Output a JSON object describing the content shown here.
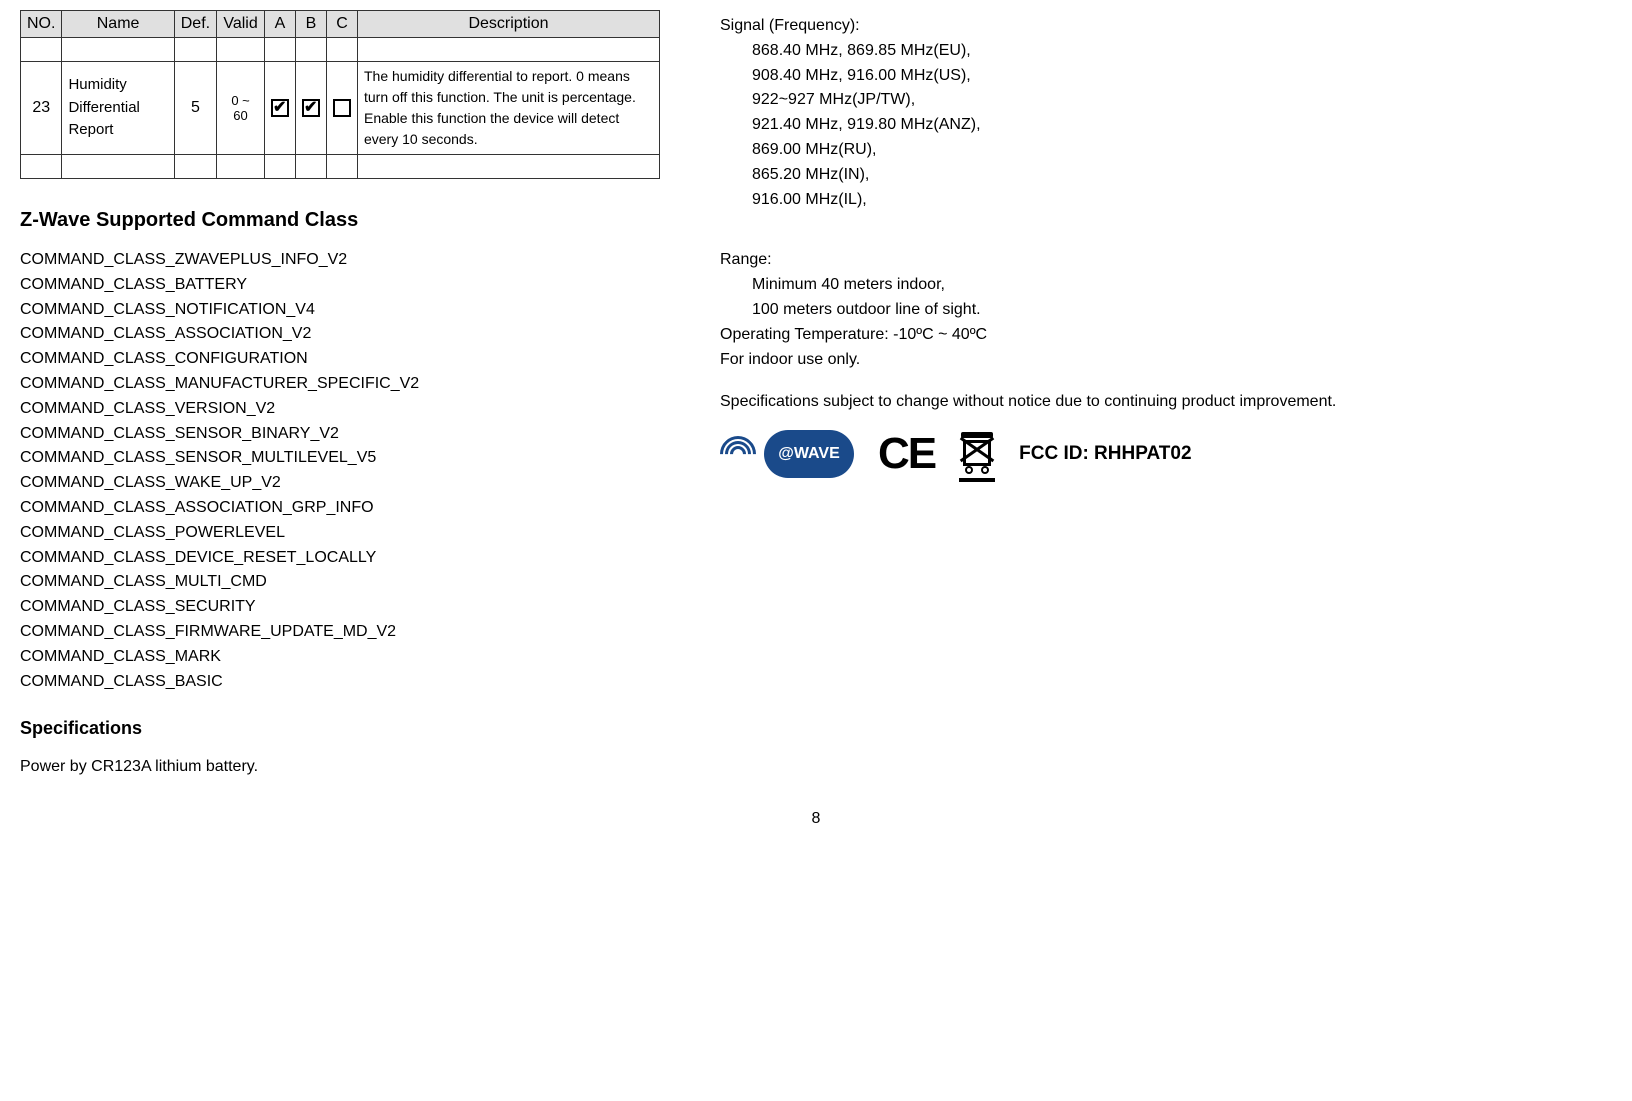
{
  "table": {
    "headers": {
      "no": "NO.",
      "name": "Name",
      "def": "Def.",
      "valid": "Valid",
      "a": "A",
      "b": "B",
      "c": "C",
      "description": "Description"
    },
    "row": {
      "no": "23",
      "name": "Humidity Differential Report",
      "def": "5",
      "valid": "0 ~ 60",
      "a_checked": true,
      "b_checked": true,
      "c_checked": false,
      "description": "The humidity differential to report. 0 means turn off this function. The unit is percentage. Enable this function the device will detect every 10 seconds."
    }
  },
  "zwave_heading": "Z-Wave Supported Command Class",
  "command_classes": [
    "COMMAND_CLASS_ZWAVEPLUS_INFO_V2",
    "COMMAND_CLASS_BATTERY",
    "COMMAND_CLASS_NOTIFICATION_V4",
    "COMMAND_CLASS_ASSOCIATION_V2",
    "COMMAND_CLASS_CONFIGURATION",
    "COMMAND_CLASS_MANUFACTURER_SPECIFIC_V2",
    "COMMAND_CLASS_VERSION_V2",
    "COMMAND_CLASS_SENSOR_BINARY_V2",
    "COMMAND_CLASS_SENSOR_MULTILEVEL_V5",
    "COMMAND_CLASS_WAKE_UP_V2",
    "COMMAND_CLASS_ASSOCIATION_GRP_INFO",
    "COMMAND_CLASS_POWERLEVEL",
    "COMMAND_CLASS_DEVICE_RESET_LOCALLY",
    "COMMAND_CLASS_MULTI_CMD",
    "COMMAND_CLASS_SECURITY",
    "COMMAND_CLASS_FIRMWARE_UPDATE_MD_V2",
    "COMMAND_CLASS_MARK",
    "COMMAND_CLASS_BASIC"
  ],
  "specifications": {
    "heading": "Specifications",
    "power": "Power by CR123A lithium battery.",
    "signal_label": "Signal (Frequency):",
    "signal_lines": [
      "868.40 MHz, 869.85 MHz(EU),",
      "908.40 MHz, 916.00 MHz(US),",
      "922~927 MHz(JP/TW),",
      "921.40 MHz, 919.80 MHz(ANZ),",
      "869.00 MHz(RU),",
      "865.20 MHz(IN),",
      "916.00 MHz(IL),"
    ],
    "range_label": "Range:",
    "range_lines": [
      "Minimum 40 meters indoor,",
      "100 meters outdoor line of sight."
    ],
    "operating_temp": "Operating Temperature: -10ºC ~ 40ºC",
    "indoor": "For indoor use only.",
    "disclaimer": "Specifications subject to change without notice due to continuing product improvement."
  },
  "zwave_bubble_text": "@WAVE",
  "ce_text": "CE",
  "fcc_id": "FCC ID: RHHPAT02",
  "page_number": "8"
}
